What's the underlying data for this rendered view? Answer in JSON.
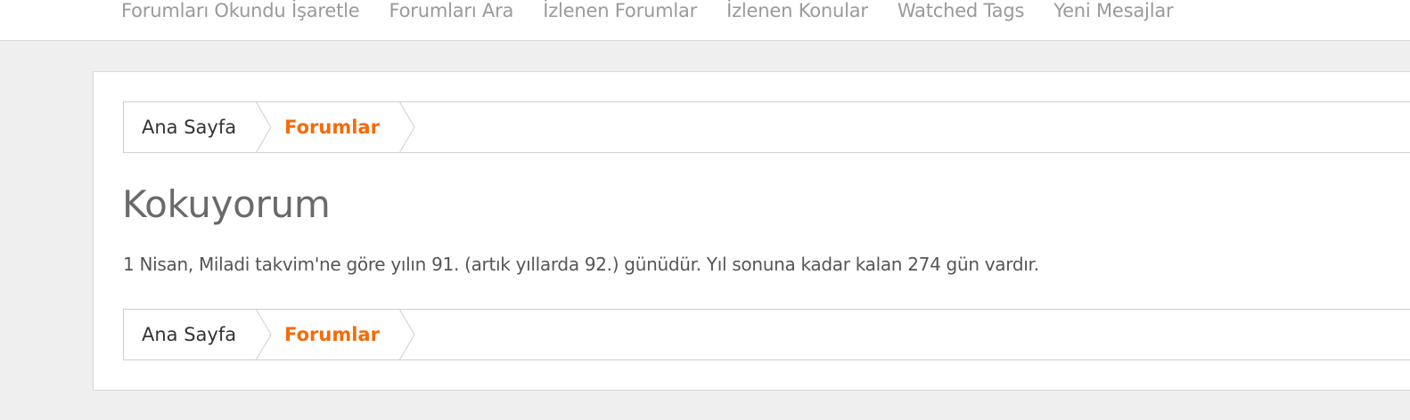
{
  "topnav": {
    "items": [
      "Forumları Okundu İşaretle",
      "Forumları Ara",
      "İzlenen Forumlar",
      "İzlenen Konular",
      "Watched Tags",
      "Yeni Mesajlar"
    ]
  },
  "breadcrumb": {
    "home": "Ana Sayfa",
    "current": "Forumlar"
  },
  "page": {
    "title": "Kokuyorum",
    "description": "1 Nisan, Miladi takvim'ne göre yılın 91. (artık yıllarda 92.) günüdür. Yıl sonuna kadar kalan 274 gün vardır."
  },
  "colors": {
    "accent": "#f56b0a",
    "background": "#efefef"
  }
}
